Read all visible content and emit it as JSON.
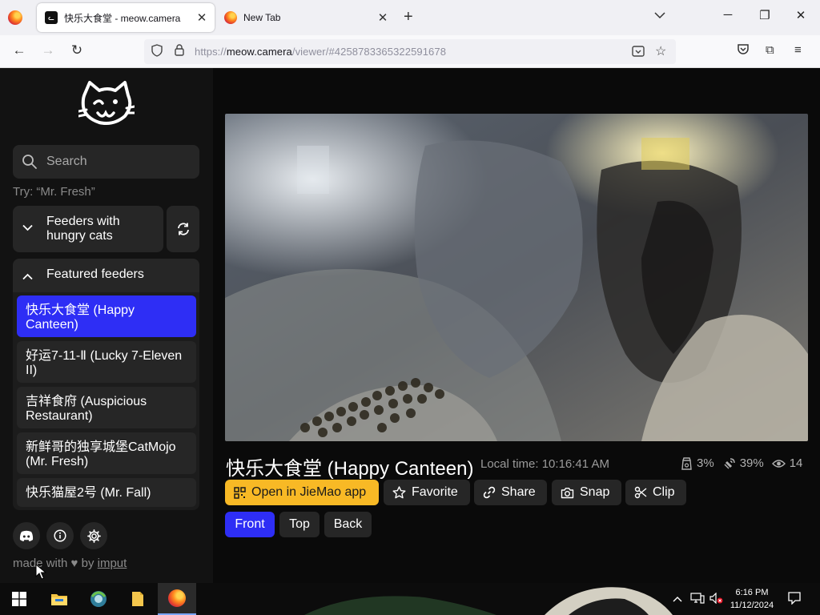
{
  "browser": {
    "tabs": [
      {
        "title": "快乐大食堂 - meow.camera",
        "active": true
      },
      {
        "title": "New Tab",
        "active": false
      }
    ],
    "url_host": "meow.camera",
    "url_path": "/viewer/#4258783365322591678",
    "url_scheme": "https://"
  },
  "sidebar": {
    "search_placeholder": "Search",
    "search_hint": "Try: “Mr. Fresh”",
    "hungry_group": "Feeders with hungry cats",
    "featured_group": "Featured feeders",
    "feeders": [
      {
        "name": "快乐大食堂 (Happy Canteen)",
        "selected": true
      },
      {
        "name": "好运7-11-Ⅱ (Lucky 7-Eleven II)",
        "selected": false
      },
      {
        "name": "吉祥食府 (Auspicious Restaurant)",
        "selected": false
      },
      {
        "name": "新鲜哥的独享城堡CatMojo (Mr. Fresh)",
        "selected": false
      },
      {
        "name": "快乐猫屋2号 (Mr. Fall)",
        "selected": false
      }
    ],
    "footer_prefix": "made with",
    "footer_by": "by",
    "footer_author": "imput"
  },
  "camera": {
    "title": "快乐大食堂 (Happy Canteen)",
    "local_time_label": "Local time:",
    "local_time": "10:16:41 AM",
    "stats": {
      "food_level": "3%",
      "signal": "39%",
      "viewers": "14"
    },
    "actions": {
      "open_app": "Open in JieMao app",
      "favorite": "Favorite",
      "share": "Share",
      "snap": "Snap",
      "clip": "Clip"
    },
    "views": [
      "Front",
      "Top",
      "Back"
    ],
    "active_view": "Front"
  },
  "taskbar": {
    "time": "6:16 PM",
    "date": "11/12/2024"
  },
  "colors": {
    "accent_blue": "#2e2ef5",
    "accent_yellow": "#f8b925",
    "panel": "#262626"
  }
}
